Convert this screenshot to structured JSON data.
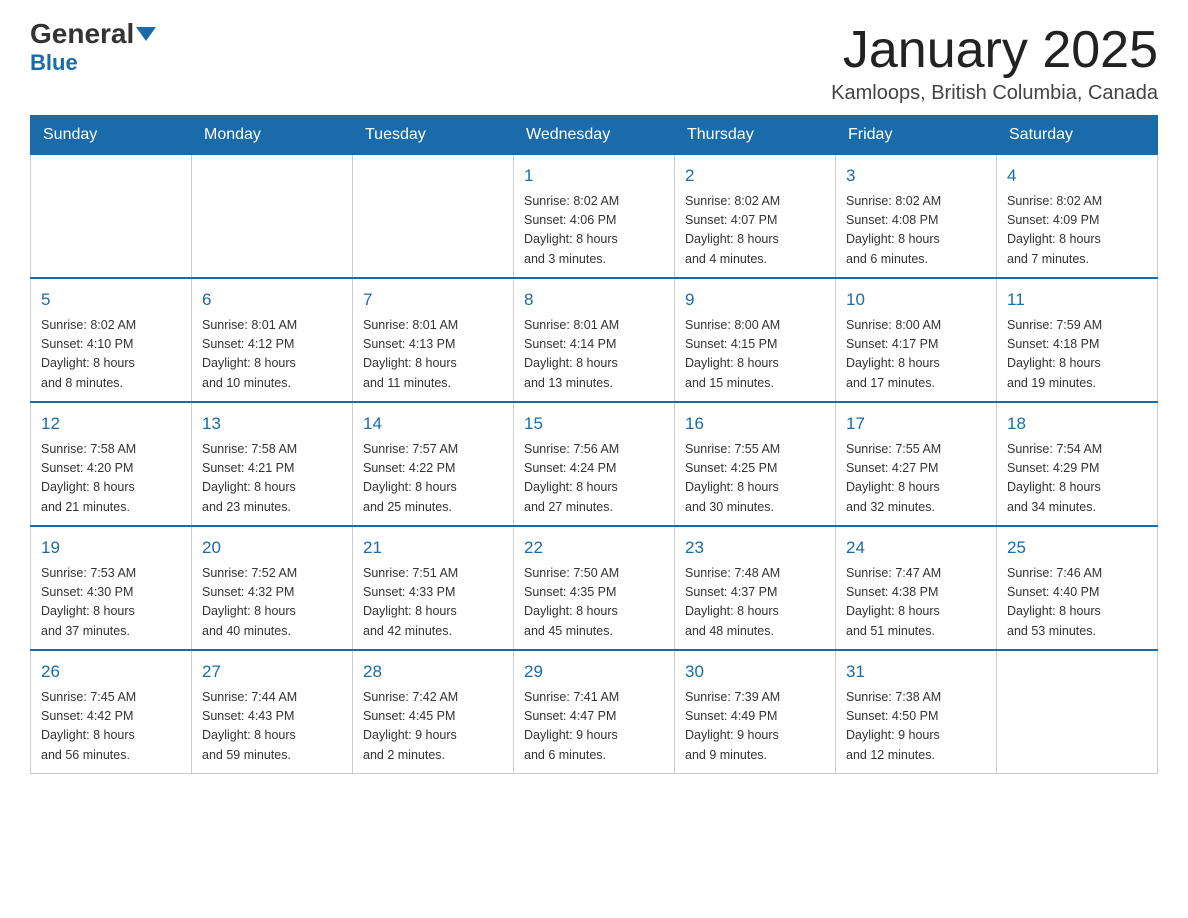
{
  "logo": {
    "general": "General",
    "blue": "Blue"
  },
  "title": "January 2025",
  "location": "Kamloops, British Columbia, Canada",
  "days_of_week": [
    "Sunday",
    "Monday",
    "Tuesday",
    "Wednesday",
    "Thursday",
    "Friday",
    "Saturday"
  ],
  "weeks": [
    [
      {
        "day": "",
        "info": ""
      },
      {
        "day": "",
        "info": ""
      },
      {
        "day": "",
        "info": ""
      },
      {
        "day": "1",
        "info": "Sunrise: 8:02 AM\nSunset: 4:06 PM\nDaylight: 8 hours\nand 3 minutes."
      },
      {
        "day": "2",
        "info": "Sunrise: 8:02 AM\nSunset: 4:07 PM\nDaylight: 8 hours\nand 4 minutes."
      },
      {
        "day": "3",
        "info": "Sunrise: 8:02 AM\nSunset: 4:08 PM\nDaylight: 8 hours\nand 6 minutes."
      },
      {
        "day": "4",
        "info": "Sunrise: 8:02 AM\nSunset: 4:09 PM\nDaylight: 8 hours\nand 7 minutes."
      }
    ],
    [
      {
        "day": "5",
        "info": "Sunrise: 8:02 AM\nSunset: 4:10 PM\nDaylight: 8 hours\nand 8 minutes."
      },
      {
        "day": "6",
        "info": "Sunrise: 8:01 AM\nSunset: 4:12 PM\nDaylight: 8 hours\nand 10 minutes."
      },
      {
        "day": "7",
        "info": "Sunrise: 8:01 AM\nSunset: 4:13 PM\nDaylight: 8 hours\nand 11 minutes."
      },
      {
        "day": "8",
        "info": "Sunrise: 8:01 AM\nSunset: 4:14 PM\nDaylight: 8 hours\nand 13 minutes."
      },
      {
        "day": "9",
        "info": "Sunrise: 8:00 AM\nSunset: 4:15 PM\nDaylight: 8 hours\nand 15 minutes."
      },
      {
        "day": "10",
        "info": "Sunrise: 8:00 AM\nSunset: 4:17 PM\nDaylight: 8 hours\nand 17 minutes."
      },
      {
        "day": "11",
        "info": "Sunrise: 7:59 AM\nSunset: 4:18 PM\nDaylight: 8 hours\nand 19 minutes."
      }
    ],
    [
      {
        "day": "12",
        "info": "Sunrise: 7:58 AM\nSunset: 4:20 PM\nDaylight: 8 hours\nand 21 minutes."
      },
      {
        "day": "13",
        "info": "Sunrise: 7:58 AM\nSunset: 4:21 PM\nDaylight: 8 hours\nand 23 minutes."
      },
      {
        "day": "14",
        "info": "Sunrise: 7:57 AM\nSunset: 4:22 PM\nDaylight: 8 hours\nand 25 minutes."
      },
      {
        "day": "15",
        "info": "Sunrise: 7:56 AM\nSunset: 4:24 PM\nDaylight: 8 hours\nand 27 minutes."
      },
      {
        "day": "16",
        "info": "Sunrise: 7:55 AM\nSunset: 4:25 PM\nDaylight: 8 hours\nand 30 minutes."
      },
      {
        "day": "17",
        "info": "Sunrise: 7:55 AM\nSunset: 4:27 PM\nDaylight: 8 hours\nand 32 minutes."
      },
      {
        "day": "18",
        "info": "Sunrise: 7:54 AM\nSunset: 4:29 PM\nDaylight: 8 hours\nand 34 minutes."
      }
    ],
    [
      {
        "day": "19",
        "info": "Sunrise: 7:53 AM\nSunset: 4:30 PM\nDaylight: 8 hours\nand 37 minutes."
      },
      {
        "day": "20",
        "info": "Sunrise: 7:52 AM\nSunset: 4:32 PM\nDaylight: 8 hours\nand 40 minutes."
      },
      {
        "day": "21",
        "info": "Sunrise: 7:51 AM\nSunset: 4:33 PM\nDaylight: 8 hours\nand 42 minutes."
      },
      {
        "day": "22",
        "info": "Sunrise: 7:50 AM\nSunset: 4:35 PM\nDaylight: 8 hours\nand 45 minutes."
      },
      {
        "day": "23",
        "info": "Sunrise: 7:48 AM\nSunset: 4:37 PM\nDaylight: 8 hours\nand 48 minutes."
      },
      {
        "day": "24",
        "info": "Sunrise: 7:47 AM\nSunset: 4:38 PM\nDaylight: 8 hours\nand 51 minutes."
      },
      {
        "day": "25",
        "info": "Sunrise: 7:46 AM\nSunset: 4:40 PM\nDaylight: 8 hours\nand 53 minutes."
      }
    ],
    [
      {
        "day": "26",
        "info": "Sunrise: 7:45 AM\nSunset: 4:42 PM\nDaylight: 8 hours\nand 56 minutes."
      },
      {
        "day": "27",
        "info": "Sunrise: 7:44 AM\nSunset: 4:43 PM\nDaylight: 8 hours\nand 59 minutes."
      },
      {
        "day": "28",
        "info": "Sunrise: 7:42 AM\nSunset: 4:45 PM\nDaylight: 9 hours\nand 2 minutes."
      },
      {
        "day": "29",
        "info": "Sunrise: 7:41 AM\nSunset: 4:47 PM\nDaylight: 9 hours\nand 6 minutes."
      },
      {
        "day": "30",
        "info": "Sunrise: 7:39 AM\nSunset: 4:49 PM\nDaylight: 9 hours\nand 9 minutes."
      },
      {
        "day": "31",
        "info": "Sunrise: 7:38 AM\nSunset: 4:50 PM\nDaylight: 9 hours\nand 12 minutes."
      },
      {
        "day": "",
        "info": ""
      }
    ]
  ]
}
